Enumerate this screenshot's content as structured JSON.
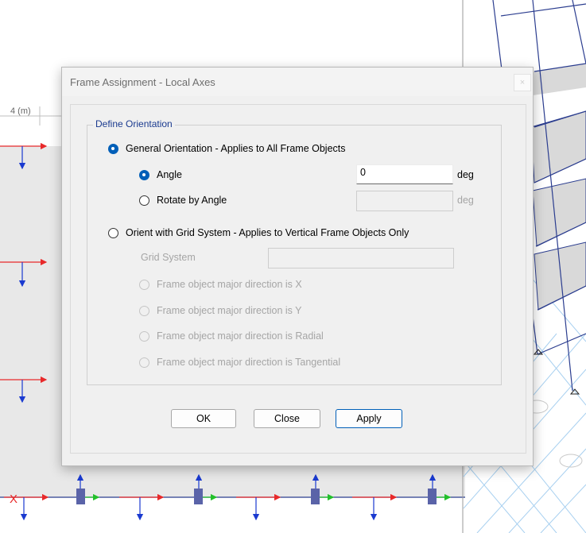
{
  "background": {
    "ruler_label": "4 (m)"
  },
  "dialog": {
    "title": "Frame Assignment - Local Axes",
    "close_glyph": "×",
    "group_title": "Define Orientation",
    "general": {
      "label": "General Orientation - Applies to All Frame Objects",
      "selected": true
    },
    "angle": {
      "label": "Angle",
      "value": "0",
      "unit": "deg",
      "selected": true
    },
    "rotate": {
      "label": "Rotate by Angle",
      "value": "",
      "unit": "deg",
      "selected": false
    },
    "grid_orient": {
      "label": "Orient with Grid System - Applies to Vertical Frame Objects Only",
      "selected": false
    },
    "grid_system": {
      "label": "Grid System",
      "value": ""
    },
    "major_options": [
      "Frame object major direction is X",
      "Frame object major direction is Y",
      "Frame object major direction is Radial",
      "Frame object major direction is Tangential"
    ],
    "buttons": {
      "ok": "OK",
      "close": "Close",
      "apply": "Apply"
    }
  },
  "colors": {
    "accent": "#005fb8",
    "group_title": "#1a3a8f",
    "disabled_text": "#a5a5a5",
    "axis_red": "#e8292a",
    "axis_green": "#22c02a",
    "axis_blue": "#1a3ad0",
    "frame_blue": "#2b3d8f"
  }
}
